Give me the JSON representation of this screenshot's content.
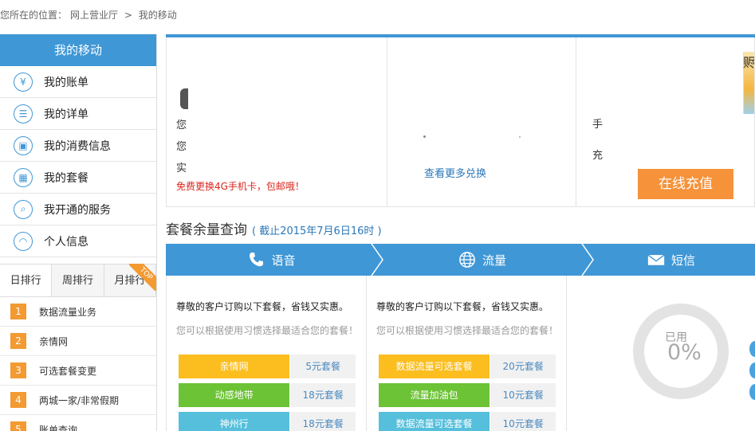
{
  "breadcrumb": {
    "prefix": "您所在的位置：",
    "home": "网上营业厅",
    "sep": ">",
    "current": "我的移动"
  },
  "sidebar": {
    "title": "我的移动",
    "items": [
      {
        "label": "我的账单",
        "icon": "yen-icon",
        "glyph": "¥"
      },
      {
        "label": "我的详单",
        "icon": "list-icon",
        "glyph": "☰"
      },
      {
        "label": "我的消费信息",
        "icon": "book-icon",
        "glyph": "▣"
      },
      {
        "label": "我的套餐",
        "icon": "package-icon",
        "glyph": "▦"
      },
      {
        "label": "我开通的服务",
        "icon": "search-icon",
        "glyph": "⌕"
      },
      {
        "label": "个人信息",
        "icon": "user-icon",
        "glyph": "◠"
      }
    ]
  },
  "ranking": {
    "tabs": [
      "日排行",
      "周排行",
      "月排行"
    ],
    "badge": "TOP",
    "items": [
      {
        "num": "1",
        "label": "数据流量业务"
      },
      {
        "num": "2",
        "label": "亲情网"
      },
      {
        "num": "3",
        "label": "可选套餐变更"
      },
      {
        "num": "4",
        "label": "两城一家/非常假期"
      },
      {
        "num": "5",
        "label": "账单查询"
      }
    ]
  },
  "panel1": {
    "line1": "您",
    "line2": "您",
    "line3": "实",
    "promo": "免费更换4G手机卡，包邮哦！"
  },
  "panel2": {
    "link": "查看更多兑换"
  },
  "panel3": {
    "char1": "手",
    "char2": "充",
    "recharge": "在线充值",
    "thumb_text": "赆"
  },
  "query": {
    "title": "套餐余量查询",
    "date": "( 截止2015年7月6日16时 )"
  },
  "tabs": [
    {
      "label": "语音",
      "icon": "phone-icon"
    },
    {
      "label": "流量",
      "icon": "globe-icon"
    },
    {
      "label": "短信",
      "icon": "envelope-icon"
    }
  ],
  "colA": {
    "intro": "尊敬的客户订购以下套餐，省钱又实惠。",
    "hint": "您可以根据使用习惯选择最适合您的套餐！",
    "packages": [
      {
        "name": "亲情网",
        "price": "5元套餐",
        "color": "#fbbe1e"
      },
      {
        "name": "动感地带",
        "price": "18元套餐",
        "color": "#6cc335"
      },
      {
        "name": "神州行",
        "price": "18元套餐",
        "color": "#55bfdc"
      }
    ]
  },
  "colB": {
    "intro": "尊敬的客户订购以下套餐，省钱又实惠。",
    "hint": "您可以根据使用习惯选择最适合您的套餐！",
    "packages": [
      {
        "name": "数据流量可选套餐",
        "price": "20元套餐",
        "color": "#fbbe1e"
      },
      {
        "name": "流量加油包",
        "price": "10元套餐",
        "color": "#6cc335"
      },
      {
        "name": "数据流量可选套餐",
        "price": "10元套餐",
        "color": "#55bfdc"
      }
    ]
  },
  "usage": {
    "label": "已用",
    "value": "0%"
  },
  "colors": {
    "accent": "#3f97d6",
    "orange": "#f39a32",
    "promo_red": "#d9261c"
  }
}
